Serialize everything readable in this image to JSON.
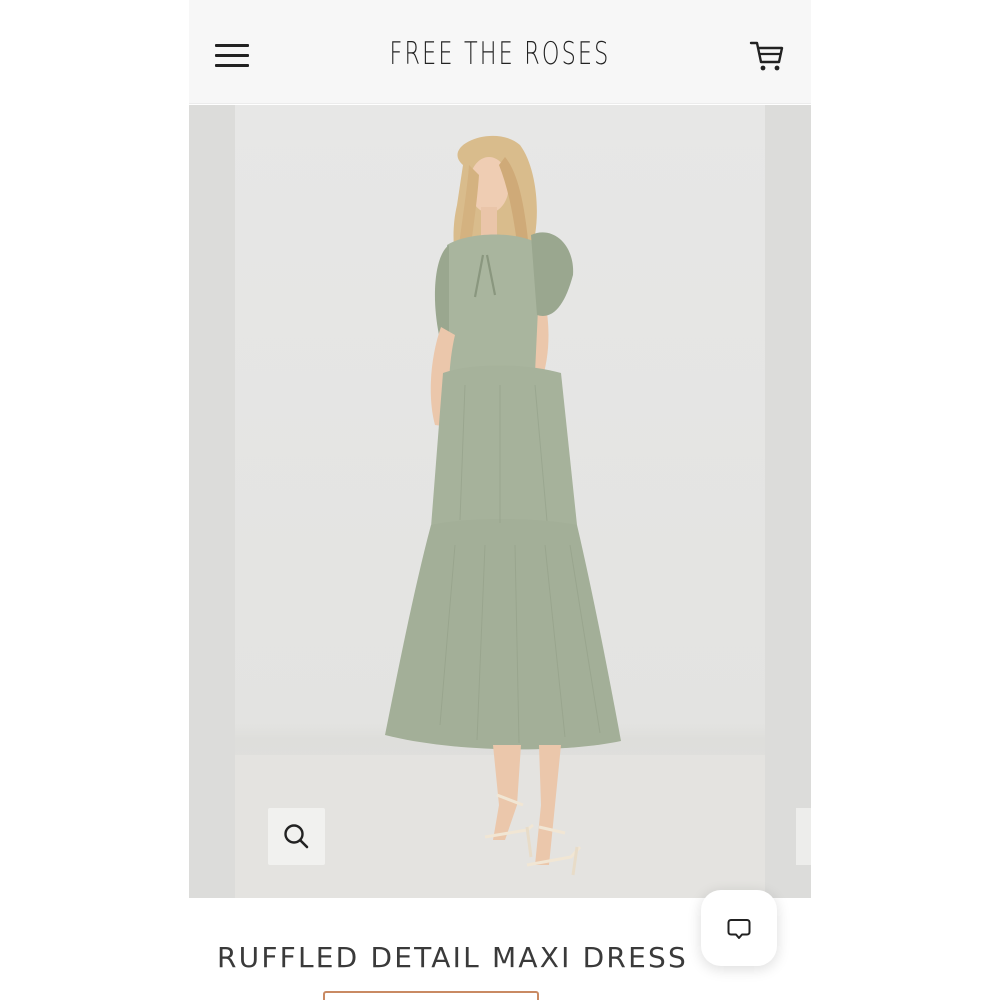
{
  "header": {
    "brand": "FREE THE ROSES",
    "menu_icon": "hamburger-menu-icon",
    "cart_icon": "shopping-cart-icon"
  },
  "gallery": {
    "image_alt": "Model wearing sage green tiered ruffled maxi dress with white strappy heels",
    "zoom_icon": "magnifier-icon"
  },
  "product": {
    "title": "RUFFLED DETAIL MAXI DRESS"
  },
  "chat": {
    "icon": "chat-bubble-icon"
  },
  "colors": {
    "dress": "#a6b29b",
    "accent_button_border": "#c98a63",
    "background": "#e4e4e2"
  }
}
